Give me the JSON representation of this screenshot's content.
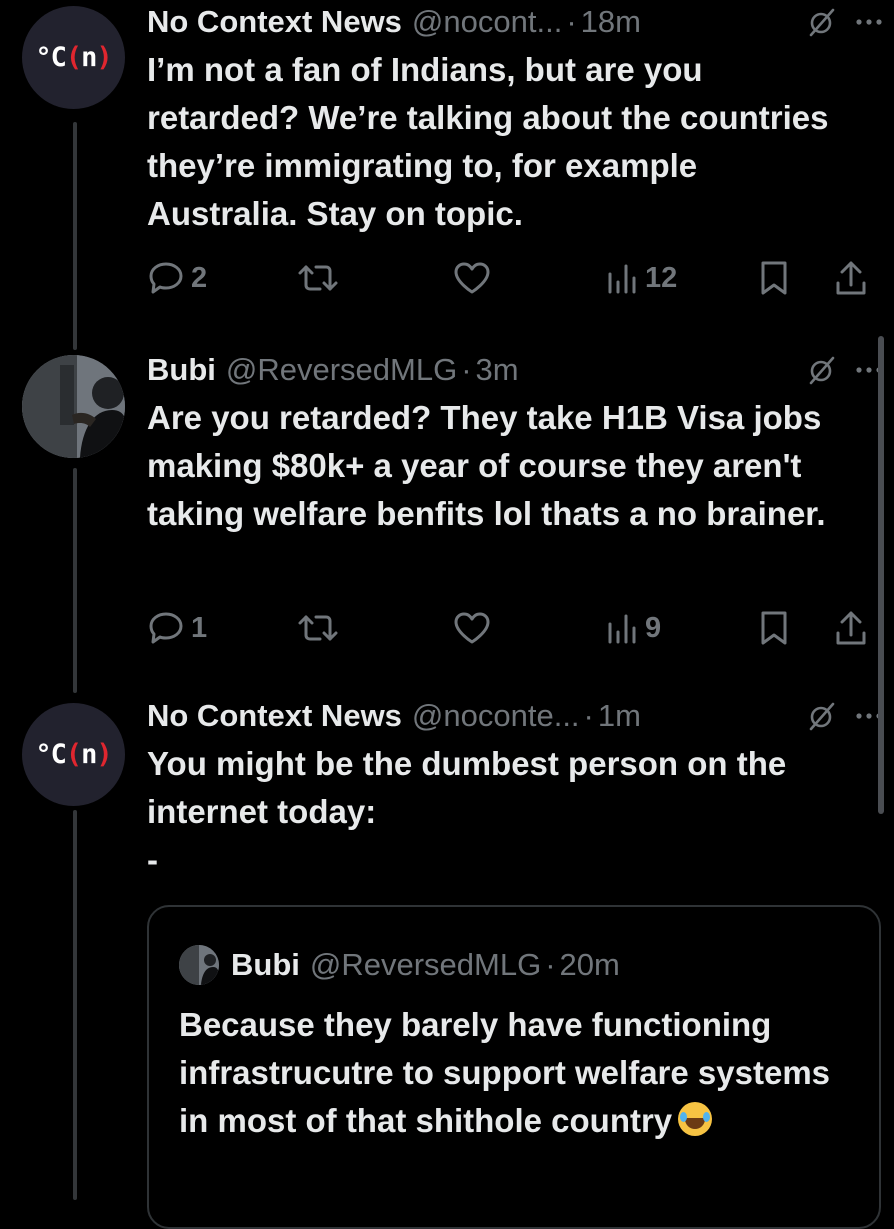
{
  "colors": {
    "background": "#000000",
    "text": "#e7e9ea",
    "muted": "#71767b",
    "thread_line": "#333639",
    "logo_red": "#e0262f"
  },
  "posts": [
    {
      "avatar": {
        "logo_prefix": "°C",
        "logo_paren_open": "(",
        "logo_letter": "n",
        "logo_paren_close": ")"
      },
      "name": "No Context News",
      "handle": "@nocont...",
      "separator": "·",
      "time": "18m",
      "text": "I’m not a fan of Indians, but are you retarded? We’re talking about the countries they’re immigrating to, for example Australia. Stay on topic.",
      "replies": "2",
      "reposts": "",
      "likes": "",
      "views": "12",
      "icons": [
        "reply-icon",
        "repost-icon",
        "like-icon",
        "views-icon",
        "bookmark-icon",
        "share-icon",
        "grok-icon",
        "more-icon"
      ]
    },
    {
      "avatar": {
        "kind": "photo"
      },
      "name": "Bubi",
      "handle": "@ReversedMLG",
      "separator": "·",
      "time": "3m",
      "text": "Are you retarded? They take H1B Visa jobs making $80k+ a year of course they aren't taking welfare benfits lol thats a no brainer.",
      "replies": "1",
      "reposts": "",
      "likes": "",
      "views": "9"
    },
    {
      "avatar": {
        "logo_prefix": "°C",
        "logo_paren_open": "(",
        "logo_letter": "n",
        "logo_paren_close": ")"
      },
      "name": "No Context News",
      "handle": "@noconte...",
      "separator": "·",
      "time": "1m",
      "text_line1": "You might be the dumbest person on the internet today:",
      "text_line2": "-",
      "quote": {
        "name": "Bubi",
        "handle": "@ReversedMLG",
        "separator": "·",
        "time": "20m",
        "text": "Because they barely have functioning infrastrucutre to support welfare systems in most of that shithole country",
        "emoji": "face-with-tears-of-joy"
      }
    }
  ]
}
